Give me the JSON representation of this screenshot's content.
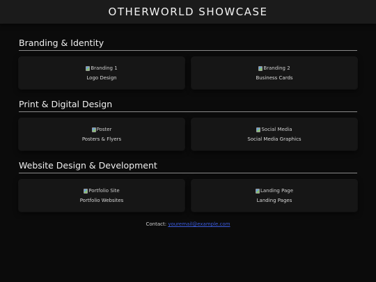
{
  "header": {
    "title": "OTHERWORLD SHOWCASE"
  },
  "sections": [
    {
      "title": "Branding & Identity",
      "cards": [
        {
          "alt": "Branding 1",
          "label": "Logo Design"
        },
        {
          "alt": "Branding 2",
          "label": "Business Cards"
        }
      ]
    },
    {
      "title": "Print & Digital Design",
      "cards": [
        {
          "alt": "Poster",
          "label": "Posters & Flyers"
        },
        {
          "alt": "Social Media",
          "label": "Social Media Graphics"
        }
      ]
    },
    {
      "title": "Website Design & Development",
      "cards": [
        {
          "alt": "Portfolio Site",
          "label": "Portfolio Websites"
        },
        {
          "alt": "Landing Page",
          "label": "Landing Pages"
        }
      ]
    }
  ],
  "footer": {
    "contact_label": "Contact:",
    "email": "youremail@example.com"
  },
  "colors": {
    "background": "#0b0b0b",
    "header_bg": "#1b1b1b",
    "card_bg": "#161616",
    "link": "#3b5bdb"
  }
}
